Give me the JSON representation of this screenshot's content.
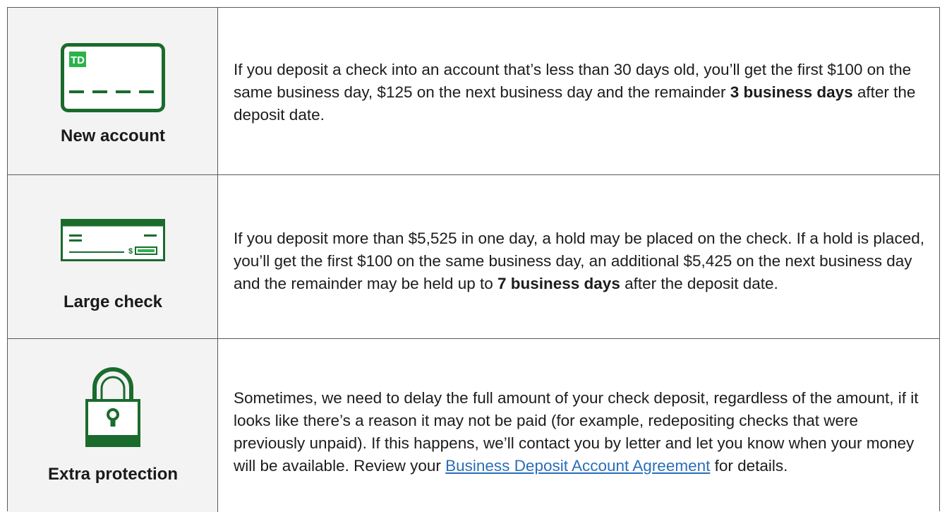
{
  "rows": [
    {
      "label": "New account",
      "icon": "td-card-icon",
      "text_before": "If you deposit a check into an account that’s less than 30 days old, you’ll get the first $100 on the same business day, $125 on the next business day and the remainder ",
      "text_bold": "3 business days",
      "text_after": " after the deposit date."
    },
    {
      "label": "Large check",
      "icon": "check-icon",
      "text_before": "If you deposit more than $5,525 in one day, a hold may be placed on the check. If a hold is placed, you’ll get the first $100 on the same business day, an additional $5,425 on the next business day and the remainder may be held up to ",
      "text_bold": "7 business days",
      "text_after": " after the deposit date."
    },
    {
      "label": "Extra protection",
      "icon": "padlock-icon",
      "text_before": "Sometimes, we need to delay the full amount of your check deposit, regardless of the amount, if it looks like there’s a reason it may not be paid (for example, redepositing checks that were previously unpaid). If this happens, we’ll contact you by letter and let you know when your money will be available. Review your ",
      "link": "Business Deposit Account Agreement",
      "text_after": " for details."
    }
  ],
  "colors": {
    "brand_green": "#1a6b2c",
    "bright_green": "#2bb34a",
    "link": "#2a6ebb",
    "icon_bg": "#f3f3f3",
    "border": "#5a5a5a"
  },
  "card_logo": "TD",
  "check_symbol": "$"
}
